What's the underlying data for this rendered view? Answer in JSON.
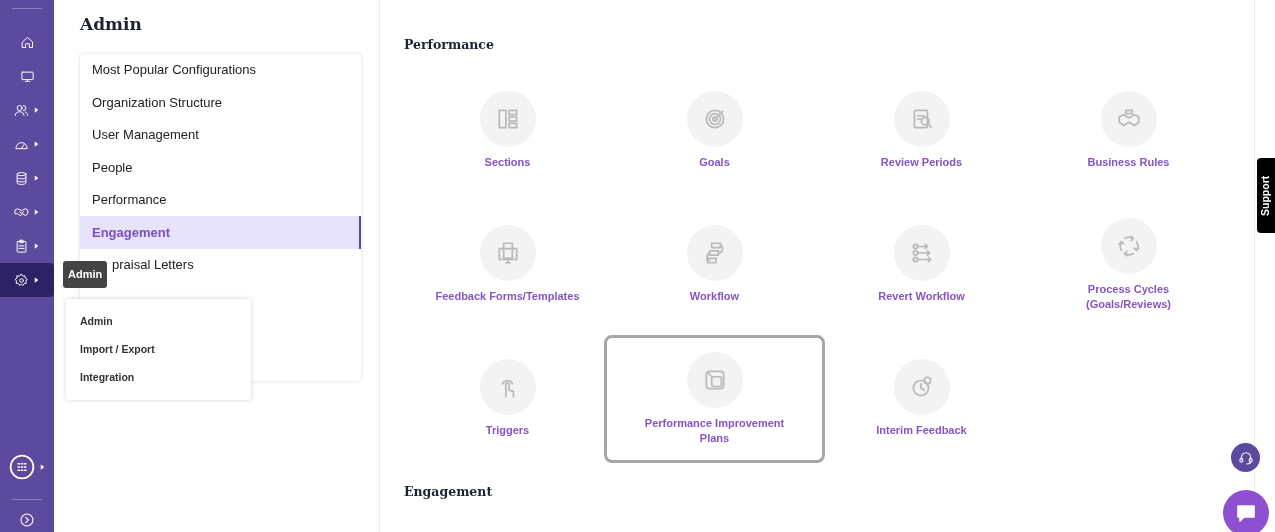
{
  "sidebar": {
    "items": [
      {
        "has_submenu": false,
        "selected": false
      },
      {
        "has_submenu": false,
        "selected": false
      },
      {
        "has_submenu": true,
        "selected": false
      },
      {
        "has_submenu": true,
        "selected": false
      },
      {
        "has_submenu": true,
        "selected": false
      },
      {
        "has_submenu": true,
        "selected": false
      },
      {
        "has_submenu": true,
        "selected": false
      },
      {
        "has_submenu": true,
        "selected": true
      }
    ],
    "bottom_items": [
      {
        "has_submenu": true
      },
      {
        "has_submenu": false
      }
    ]
  },
  "tooltip": "Admin",
  "flyout_menu": [
    "Admin",
    "Import / Export",
    "Integration"
  ],
  "admin_panel": {
    "title": "Admin",
    "items": [
      {
        "label": "Most Popular Configurations",
        "selected": false
      },
      {
        "label": "Organization Structure",
        "selected": false
      },
      {
        "label": "User Management",
        "selected": false
      },
      {
        "label": "People",
        "selected": false
      },
      {
        "label": "Performance",
        "selected": false
      },
      {
        "label": "Engagement",
        "selected": true
      },
      {
        "label": "praisal Letters",
        "selected": false
      }
    ]
  },
  "sections": [
    {
      "title": "Performance",
      "tiles": [
        {
          "label": "Sections",
          "selected": false
        },
        {
          "label": "Goals",
          "selected": false
        },
        {
          "label": "Review Periods",
          "selected": false
        },
        {
          "label": "Business Rules",
          "selected": false
        },
        {
          "label": "Feedback Forms/Templates",
          "selected": false
        },
        {
          "label": "Workflow",
          "selected": false
        },
        {
          "label": "Revert Workflow",
          "selected": false
        },
        {
          "label": "Process Cycles (Goals/Reviews)",
          "selected": false
        },
        {
          "label": "Triggers",
          "selected": false
        },
        {
          "label": "Performance Improvement Plans",
          "selected": true
        },
        {
          "label": "Interim Feedback",
          "selected": false
        }
      ]
    },
    {
      "title": "Engagement"
    }
  ],
  "support_tab": "Support"
}
